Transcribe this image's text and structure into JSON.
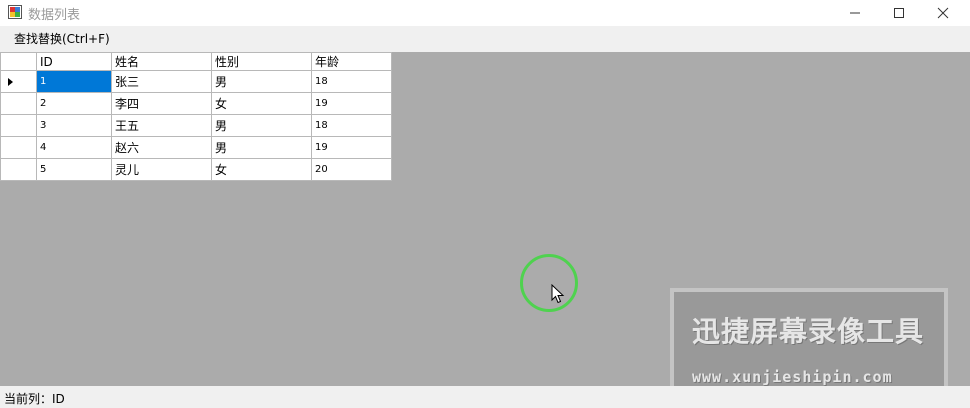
{
  "window": {
    "title": "数据列表"
  },
  "menu": {
    "items": [
      {
        "label": "查找替换(Ctrl+F)"
      }
    ]
  },
  "grid": {
    "columns": [
      "ID",
      "姓名",
      "性别",
      "年龄"
    ],
    "rows": [
      {
        "id": "1",
        "name": "张三",
        "gender": "男",
        "age": "18"
      },
      {
        "id": "2",
        "name": "李四",
        "gender": "女",
        "age": "19"
      },
      {
        "id": "3",
        "name": "王五",
        "gender": "男",
        "age": "18"
      },
      {
        "id": "4",
        "name": "赵六",
        "gender": "男",
        "age": "19"
      },
      {
        "id": "5",
        "name": "灵儿",
        "gender": "女",
        "age": "20"
      }
    ],
    "selected_row": 1,
    "selected_column": "ID"
  },
  "watermark": {
    "title": "迅捷屏幕录像工具",
    "url": "www.xunjieshipin.com"
  },
  "status": {
    "text": "当前列：ID"
  },
  "colors": {
    "selection": "#0078d7",
    "background": "#ababab",
    "cursor_ring": "#4fd24f"
  }
}
